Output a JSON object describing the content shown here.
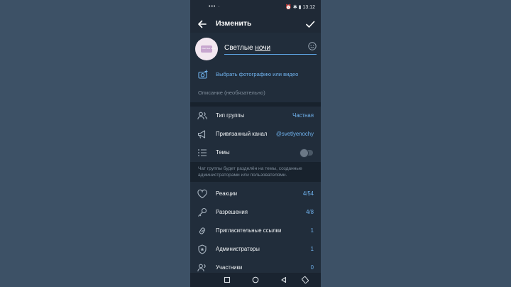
{
  "status_bar": {
    "left_icons": "••• ·",
    "time": "13:12"
  },
  "app_bar": {
    "title": "Изменить"
  },
  "group": {
    "avatar_text": "Светлые ночи",
    "name_part1": "Светлые ",
    "name_part2": "ночи",
    "set_photo_label": "Выбрать фотографию или видео",
    "description_placeholder": "Описание (необязательно)"
  },
  "settings": [
    {
      "label": "Тип группы",
      "value": "Частная",
      "icon": "people-icon"
    },
    {
      "label": "Привязанный канал",
      "value": "@svetlyenochy",
      "icon": "megaphone-icon"
    },
    {
      "label": "Темы",
      "value": "",
      "icon": "topics-icon",
      "toggle": "off"
    }
  ],
  "topics_hint": "Чат группы будет разделён на темы, созданные администраторами или пользователями.",
  "management": [
    {
      "label": "Реакции",
      "value": "4/54",
      "icon": "heart-icon"
    },
    {
      "label": "Разрешения",
      "value": "4/8",
      "icon": "key-icon"
    },
    {
      "label": "Пригласительные ссылки",
      "value": "1",
      "icon": "link-icon"
    },
    {
      "label": "Администраторы",
      "value": "1",
      "icon": "shield-icon"
    },
    {
      "label": "Участники",
      "value": "0",
      "icon": "members-icon"
    }
  ],
  "colors": {
    "accent": "#6fb1ec",
    "background": "#212d3b",
    "outer": "#3d5166"
  }
}
